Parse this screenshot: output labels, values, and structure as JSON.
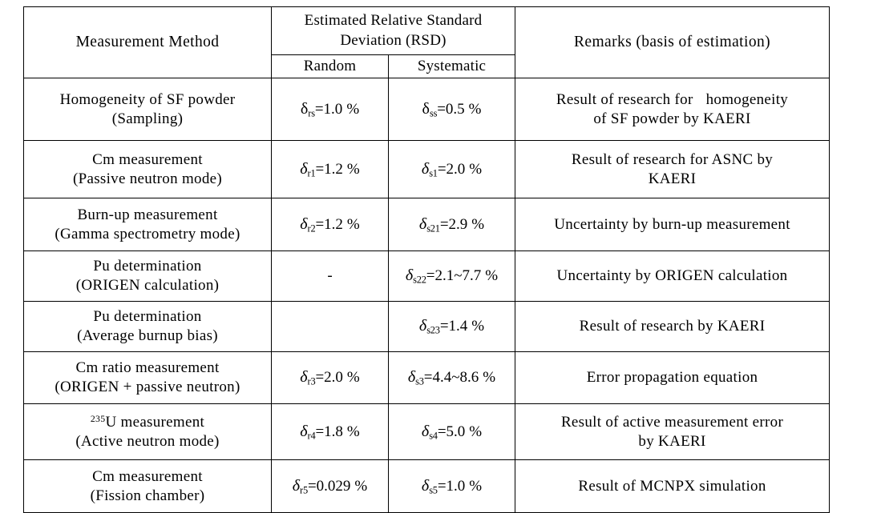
{
  "table": {
    "headers": {
      "method": "Measurement Method",
      "rsd_group": "Estimated Relative Standard Deviation (RSD)",
      "rsd_group_line1": "Estimated Relative Standard",
      "rsd_group_line2": "Deviation (RSD)",
      "random": "Random",
      "systematic": "Systematic",
      "remarks": "Remarks (basis of estimation)"
    },
    "rows": [
      {
        "method_line1": "Homogeneity of SF powder",
        "method_line2": "(Sampling)",
        "random": {
          "symbol": "δ",
          "symbol_style": "upright",
          "subscript": "rs",
          "value": "=1.0",
          "unit": "%"
        },
        "systematic": {
          "symbol": "δ",
          "symbol_style": "upright",
          "subscript": "ss",
          "value": "=0.5",
          "unit": "%"
        },
        "remark_line1": "Result of research for",
        "remark_line1b": "homogeneity",
        "remark_line2": "of SF powder by KAERI"
      },
      {
        "method_line1": "Cm measurement",
        "method_line2": "(Passive neutron mode)",
        "random": {
          "symbol": "δ",
          "symbol_style": "italic",
          "subscript": "r1",
          "value": "=1.2",
          "unit": "%"
        },
        "systematic": {
          "symbol": "δ",
          "symbol_style": "italic",
          "subscript": "s1",
          "value": "=2.0",
          "unit": "%"
        },
        "remark_line1": "Result of research for ASNC by",
        "remark_line2": "KAERI"
      },
      {
        "method_line1": "Burn-up measurement",
        "method_line2": "(Gamma spectrometry mode)",
        "random": {
          "symbol": "δ",
          "symbol_style": "italic",
          "subscript": "r2",
          "value": "=1.2",
          "unit": "%"
        },
        "systematic": {
          "symbol": "δ",
          "symbol_style": "italic",
          "subscript": "s21",
          "value": "=2.9",
          "unit": "%"
        },
        "remark_line1": "Uncertainty by burn-up measurement",
        "remark_line2": ""
      },
      {
        "method_line1": "Pu determination",
        "method_line2": "(ORIGEN calculation)",
        "random_plain": "-",
        "systematic": {
          "symbol": "δ",
          "symbol_style": "italic",
          "subscript": "s22",
          "value": "=2.1~7.7",
          "unit": "%"
        },
        "remark_line1": "Uncertainty by ORIGEN calculation",
        "remark_line2": ""
      },
      {
        "method_line1": "Pu determination",
        "method_line2": "(Average burnup bias)",
        "random_plain": "",
        "systematic": {
          "symbol": "δ",
          "symbol_style": "italic",
          "subscript": "s23",
          "value": "=1.4",
          "unit": "%"
        },
        "remark_line1": "Result of research by KAERI",
        "remark_line2": ""
      },
      {
        "method_line1": "Cm ratio measurement",
        "method_line2": "(ORIGEN + passive neutron)",
        "random": {
          "symbol": "δ",
          "symbol_style": "italic",
          "subscript": "r3",
          "value": "=2.0",
          "unit": "%"
        },
        "systematic": {
          "symbol": "δ",
          "symbol_style": "italic",
          "subscript": "s3",
          "value": "=4.4~8.6",
          "unit": "%"
        },
        "remark_line1": "Error propagation equation",
        "remark_line2": ""
      },
      {
        "method_superscript": "235",
        "method_line1_rest": "U measurement",
        "method_line2": "(Active neutron mode)",
        "random": {
          "symbol": "δ",
          "symbol_style": "italic",
          "subscript": "r4",
          "value": "=1.8",
          "unit": "%"
        },
        "systematic": {
          "symbol": "δ",
          "symbol_style": "italic",
          "subscript": "s4",
          "value": "=5.0",
          "unit": "%"
        },
        "remark_line1": "Result of active measurement error",
        "remark_line2": "by KAERI"
      },
      {
        "method_line1": "Cm measurement",
        "method_line2": "(Fission chamber)",
        "random": {
          "symbol": "δ",
          "symbol_style": "italic",
          "subscript": "r5",
          "value": "=0.029",
          "unit": "%"
        },
        "systematic": {
          "symbol": "δ",
          "symbol_style": "italic",
          "subscript": "s5",
          "value": "=1.0",
          "unit": "%"
        },
        "remark_line1": "Result of MCNPX simulation",
        "remark_line2": ""
      }
    ]
  }
}
